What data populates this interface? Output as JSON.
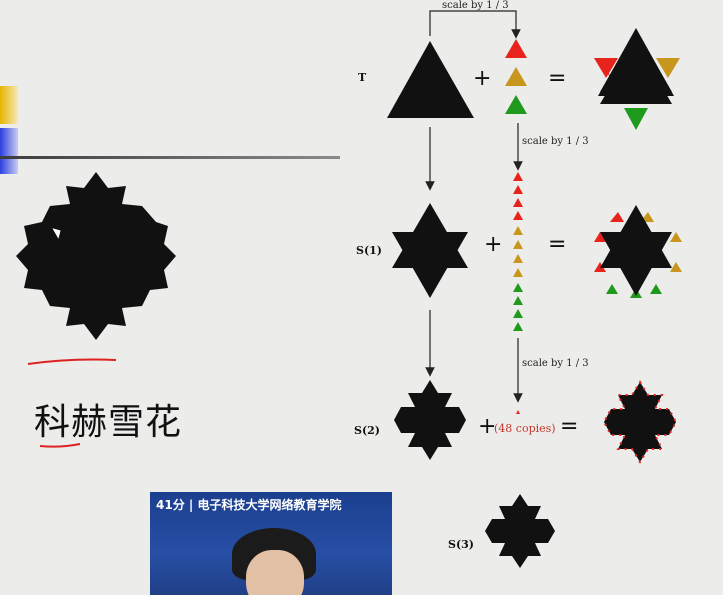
{
  "scale_top": "scale by 1 / 3",
  "scale_mid": "scale by 1 / 3",
  "scale_low": "scale by 1 / 3",
  "labels": {
    "t": "T",
    "s1": "S(1)",
    "s2": "S(2)",
    "s3": "S(3)"
  },
  "operators": {
    "plus": "+",
    "equals": "="
  },
  "copies_note": "(48 copies)",
  "title": "科赫雪花",
  "video_caption": "41分 | 电子科技大学网络教育学院",
  "colors": {
    "red": "#e8231c",
    "gold": "#c8961c",
    "green": "#1f9a1c",
    "accent_yellow": "#d8a300",
    "accent_blue": "#2a3ee0",
    "ink": "#111111"
  }
}
